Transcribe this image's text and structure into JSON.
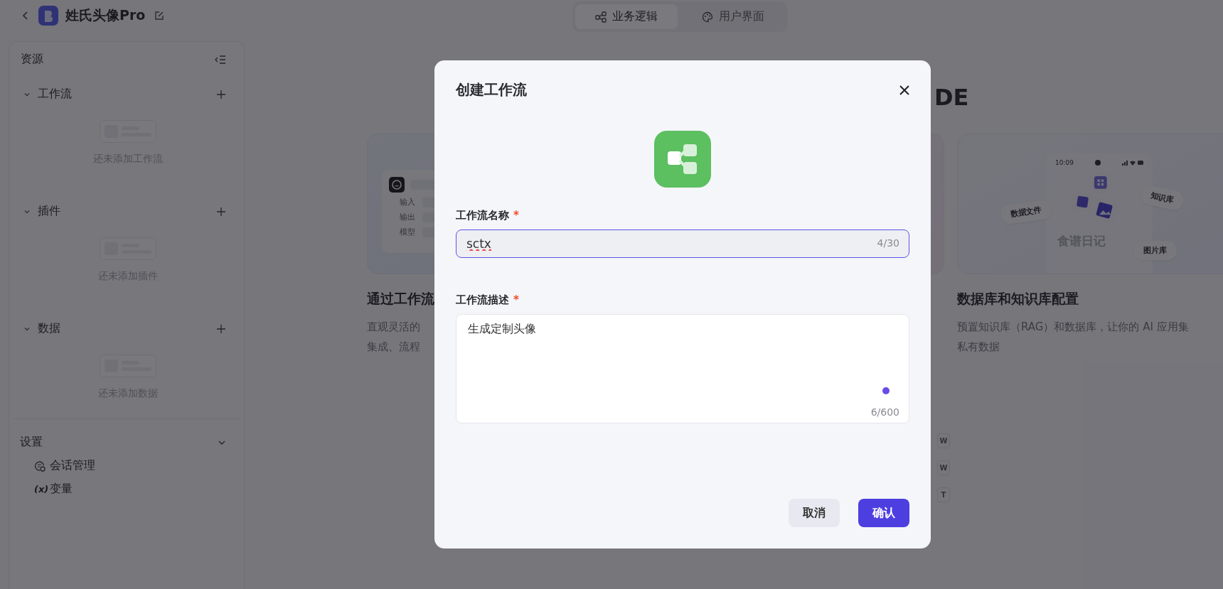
{
  "header": {
    "title": "姓氏头像Pro",
    "tabs": [
      {
        "label": "业务逻辑",
        "kind": "logic",
        "selected": true
      },
      {
        "label": "用户界面",
        "kind": "ui",
        "selected": false
      }
    ]
  },
  "sidebar": {
    "title": "资源",
    "sections": [
      {
        "title": "工作流",
        "expanded": true,
        "empty_text": "还未添加工作流"
      },
      {
        "title": "插件",
        "expanded": true,
        "empty_text": "还未添加插件"
      },
      {
        "title": "数据",
        "expanded": true,
        "empty_text": "还未添加数据"
      }
    ],
    "settings": {
      "title": "设置",
      "expanded": true,
      "items": [
        {
          "label": "会话管理",
          "kind": "chat"
        },
        {
          "label": "变量",
          "kind": "variable",
          "icon_text": "(x)"
        }
      ]
    }
  },
  "main": {
    "heading": "DE",
    "cards": [
      {
        "kind": "node",
        "title": "通过工作流",
        "description": [
          "直观灵活的",
          "集成、流程"
        ],
        "fields": [
          "输入",
          "输出",
          "模型"
        ]
      },
      {
        "kind": "blank"
      },
      {
        "kind": "phone",
        "title": "数据库和知识库配置",
        "description": [
          "预置知识库（RAG）和数据库，让你的 AI 应用集",
          "私有数据"
        ],
        "time": "10:09",
        "app_name": "食谱日记",
        "tags": [
          "数据文件",
          "知识库",
          "图片库"
        ]
      }
    ],
    "keys": [
      "W",
      "W",
      "T"
    ]
  },
  "dialog": {
    "title": "创建工作流",
    "fields": [
      {
        "kind": "input",
        "label": "工作流名称",
        "required_mark": "*",
        "focused": true,
        "value": "sctx",
        "counter": "4/30"
      },
      {
        "kind": "textarea",
        "label": "工作流描述",
        "required_mark": "*",
        "focused": false,
        "value": "生成定制头像",
        "counter": "6/600"
      }
    ],
    "buttons": [
      {
        "kind": "secondary",
        "label": "取消"
      },
      {
        "kind": "primary",
        "label": "确认"
      }
    ]
  }
}
